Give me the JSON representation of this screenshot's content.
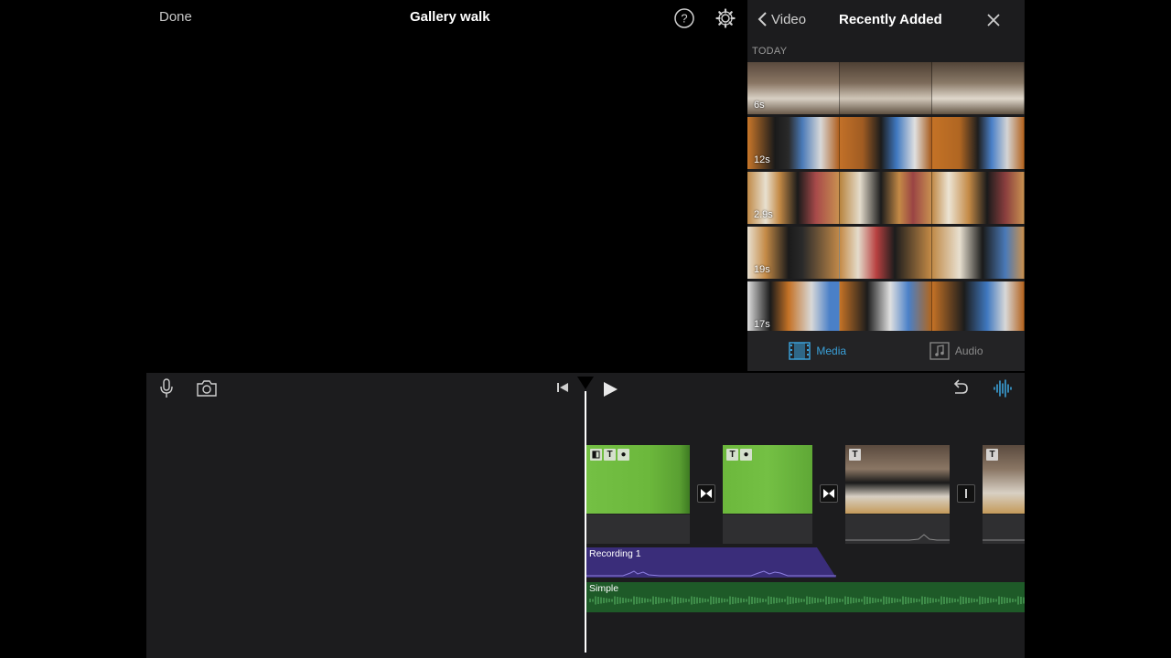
{
  "top_bar": {
    "done_label": "Done",
    "project_title": "Gallery walk",
    "help_icon": "question-circle-icon",
    "settings_icon": "gear-icon"
  },
  "media_browser": {
    "back_label": "Video",
    "title": "Recently Added",
    "section_label": "TODAY",
    "clips": [
      {
        "duration": "6s"
      },
      {
        "duration": "12s"
      },
      {
        "duration": "2.9s"
      },
      {
        "duration": "19s"
      },
      {
        "duration": "17s"
      }
    ],
    "tabs": [
      {
        "label": "Media",
        "icon": "film-icon",
        "active": true
      },
      {
        "label": "Audio",
        "icon": "music-note-icon",
        "active": false
      }
    ],
    "accent_color": "#3aa0d8"
  },
  "timeline": {
    "audio_tracks": {
      "voiceover_label": "Recording 1",
      "music_label": "Simple"
    },
    "colors": {
      "voiceover": "#3a2d7a",
      "music": "#1e5a28",
      "green_screen": "#6cb83c"
    }
  }
}
